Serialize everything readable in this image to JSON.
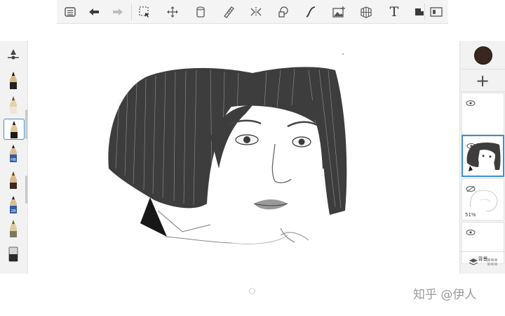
{
  "toolbar": {
    "items": [
      {
        "name": "list-icon"
      },
      {
        "name": "undo-icon"
      },
      {
        "name": "redo-icon"
      },
      {
        "name": "selection-icon"
      },
      {
        "name": "transform-icon"
      },
      {
        "name": "fill-bucket-icon"
      },
      {
        "name": "ruler-icon"
      },
      {
        "name": "symmetry-icon"
      },
      {
        "name": "shapes-icon"
      },
      {
        "name": "curve-icon"
      },
      {
        "name": "add-image-icon"
      },
      {
        "name": "perspective-grid-icon"
      },
      {
        "name": "text-icon"
      },
      {
        "name": "layers-toggle-icon"
      },
      {
        "name": "fullscreen-icon"
      }
    ],
    "text_tool_glyph": "T"
  },
  "brushes": {
    "labels": [
      "HB",
      "2B"
    ]
  },
  "layers": {
    "opacity": "51%",
    "background_label": "背景"
  },
  "watermark": "知乎 @伊人",
  "colors": {
    "accent": "#3b8ed6",
    "current_color": "#3a2620",
    "panel": "#f2f2f2"
  }
}
